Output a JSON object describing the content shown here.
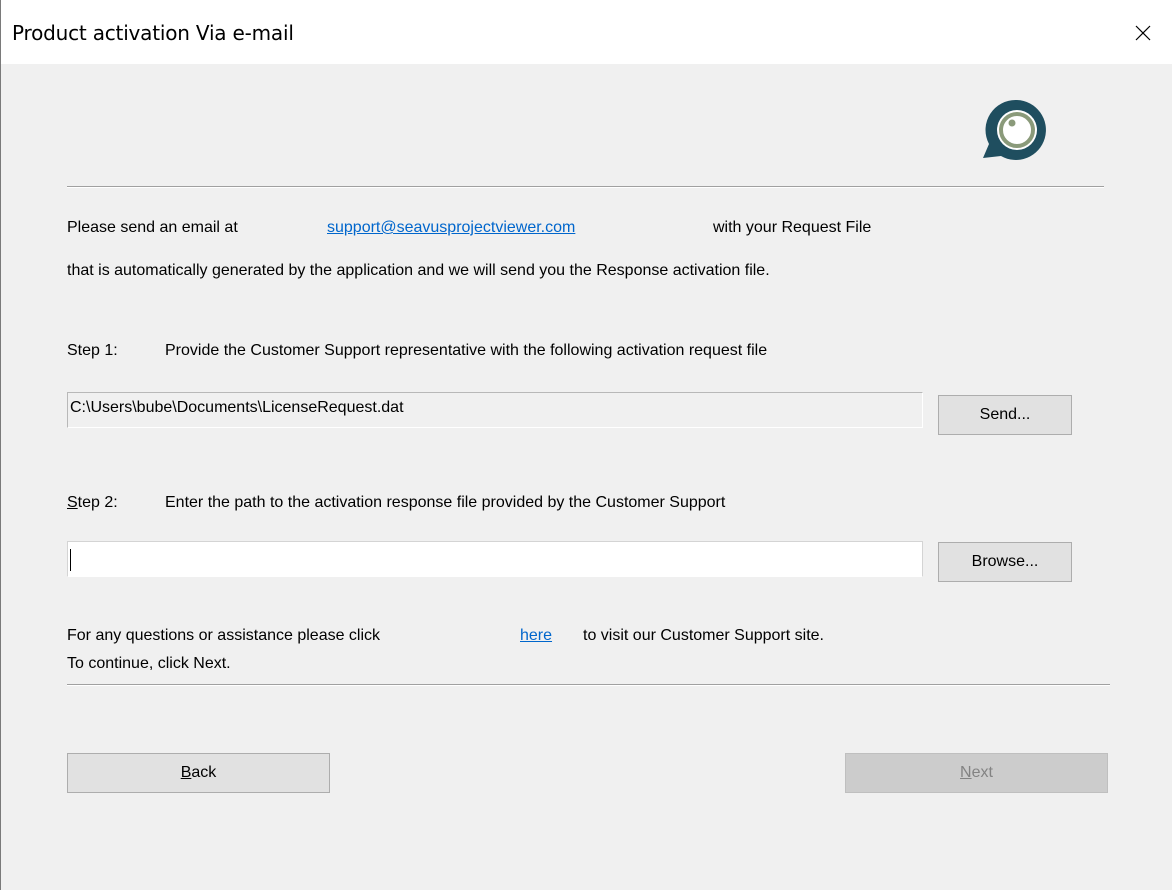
{
  "window": {
    "title": "Product activation Via e-mail"
  },
  "intro": {
    "line1_prefix": "Please send an email at",
    "email_link": "support@seavusprojectviewer.com",
    "line1_suffix": "with your Request File",
    "line2": "that is automatically generated by the application and we will send you the Response activation file."
  },
  "step1": {
    "label": "Step 1:",
    "description": "Provide the Customer Support representative with the following activation request file",
    "file_path": "C:\\Users\\bube\\Documents\\LicenseRequest.dat",
    "send_button": "Send..."
  },
  "step2": {
    "label_mnemonic": "S",
    "label_rest": "tep 2:",
    "description": "Enter the path to the activation response file provided by the Customer Support",
    "response_path": "",
    "browse_button": "Browse..."
  },
  "footer": {
    "help_prefix": "For any questions or assistance please click",
    "help_link": "here",
    "help_suffix": "to visit our Customer Support site.",
    "continue_text": "To continue, click Next."
  },
  "nav": {
    "back_mnemonic": "B",
    "back_rest": "ack",
    "next_mnemonic": "N",
    "next_rest": "ext",
    "next_disabled": true
  },
  "colors": {
    "link": "#0066cc",
    "logo_ring": "#8a9a7a",
    "logo_body": "#1f4e5f"
  },
  "icons": {
    "close": "close-icon",
    "logo": "seavus-logo-icon"
  }
}
